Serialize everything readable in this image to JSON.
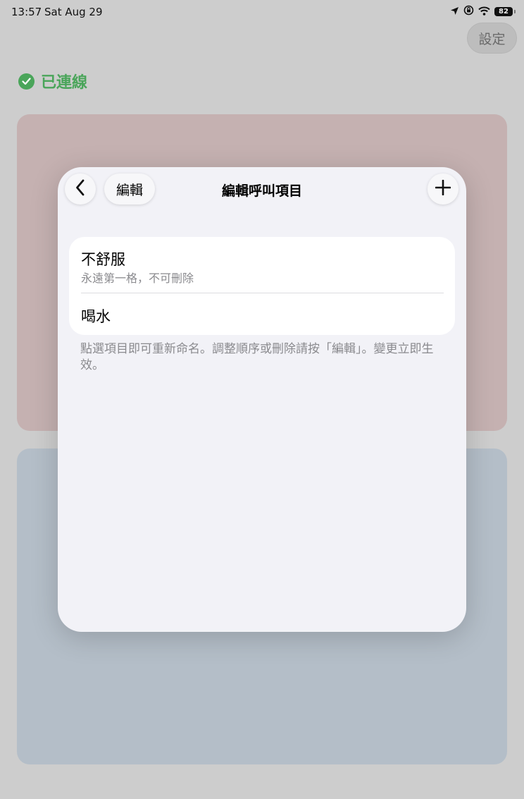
{
  "status_bar": {
    "time": "13:57",
    "date": "Sat Aug 29",
    "battery": "82",
    "icons": [
      "location-icon",
      "screen-lock-icon",
      "wifi-icon",
      "battery-icon"
    ]
  },
  "header": {
    "settings_label": "設定",
    "connection_label": "已連線",
    "connection_color": "#4aa55a"
  },
  "modal": {
    "title": "編輯呼叫項目",
    "edit_label": "編輯",
    "items": [
      {
        "title": "不舒服",
        "subtitle": "永遠第一格，不可刪除"
      },
      {
        "title": "喝水"
      }
    ],
    "footnote": "點選項目即可重新命名。調整順序或刪除請按「編輯」。變更立即生效。"
  },
  "colors": {
    "background": "#cdcdcd",
    "card_top": "#c5b1b1",
    "card_bottom": "#b4bec8",
    "modal_bg": "#f2f2f7"
  }
}
